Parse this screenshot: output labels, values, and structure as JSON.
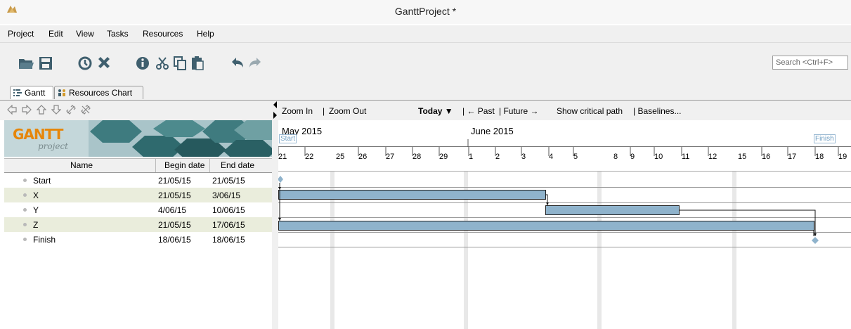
{
  "app": {
    "title": "GanttProject *"
  },
  "menu": [
    "Project",
    "Edit",
    "View",
    "Tasks",
    "Resources",
    "Help"
  ],
  "toolbar": {
    "icons": [
      "open-folder-icon",
      "save-icon",
      "history-icon",
      "delete-icon",
      "info-icon",
      "cut-icon",
      "copy-icon",
      "paste-icon",
      "undo-icon",
      "redo-icon"
    ],
    "search_placeholder": "Search <Ctrl+F>"
  },
  "tabs": [
    {
      "label": "Gantt",
      "icon": "gantt-icon"
    },
    {
      "label": "Resources Chart",
      "icon": "resources-icon"
    }
  ],
  "logo": {
    "main": "GANTT",
    "sub": "project"
  },
  "table": {
    "columns": [
      "Name",
      "Begin date",
      "End date"
    ],
    "rows": [
      {
        "name": "Start",
        "begin": "21/05/15",
        "end": "21/05/15"
      },
      {
        "name": "X",
        "begin": "21/05/15",
        "end": "3/06/15"
      },
      {
        "name": "Y",
        "begin": "4/06/15",
        "end": "10/06/15"
      },
      {
        "name": "Z",
        "begin": "21/05/15",
        "end": "17/06/15"
      },
      {
        "name": "Finish",
        "begin": "18/06/15",
        "end": "18/06/15"
      }
    ]
  },
  "chart_toolbar": {
    "zoom_in": "Zoom In",
    "sep": "|",
    "zoom_out": "Zoom Out",
    "today": "Today ▼",
    "past": "| ← Past",
    "future": "| Future →",
    "critical": "Show critical path",
    "baselines": "| Baselines..."
  },
  "timeline": {
    "months": [
      "May 2015",
      "June 2015"
    ],
    "days": [
      "21",
      "22",
      "25",
      "26",
      "27",
      "28",
      "29",
      "1",
      "2",
      "3",
      "4",
      "5",
      "8",
      "9",
      "10",
      "11",
      "12",
      "15",
      "16",
      "17",
      "18",
      "19"
    ],
    "start_flag": "Start",
    "finish_flag": "Finish"
  },
  "colors": {
    "bar": "#8fb3cc",
    "bar_border": "#222222",
    "milestone": "#8fb3cc",
    "alt_row": "#eaeddc"
  }
}
